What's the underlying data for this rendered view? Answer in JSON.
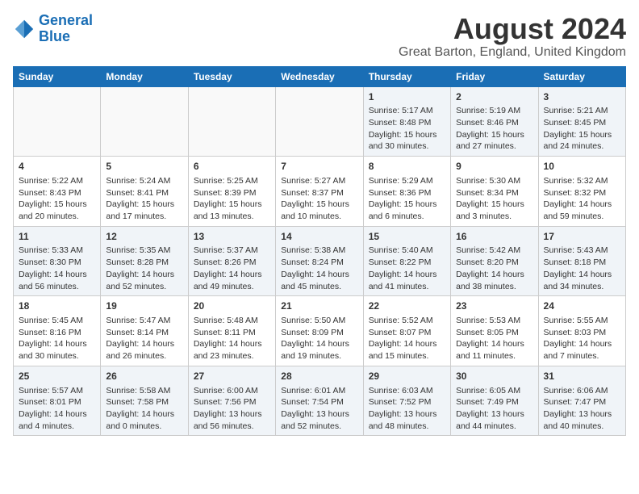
{
  "logo": {
    "line1": "General",
    "line2": "Blue"
  },
  "title": "August 2024",
  "subtitle": "Great Barton, England, United Kingdom",
  "days_of_week": [
    "Sunday",
    "Monday",
    "Tuesday",
    "Wednesday",
    "Thursday",
    "Friday",
    "Saturday"
  ],
  "weeks": [
    [
      {
        "day": "",
        "content": ""
      },
      {
        "day": "",
        "content": ""
      },
      {
        "day": "",
        "content": ""
      },
      {
        "day": "",
        "content": ""
      },
      {
        "day": "1",
        "content": "Sunrise: 5:17 AM\nSunset: 8:48 PM\nDaylight: 15 hours\nand 30 minutes."
      },
      {
        "day": "2",
        "content": "Sunrise: 5:19 AM\nSunset: 8:46 PM\nDaylight: 15 hours\nand 27 minutes."
      },
      {
        "day": "3",
        "content": "Sunrise: 5:21 AM\nSunset: 8:45 PM\nDaylight: 15 hours\nand 24 minutes."
      }
    ],
    [
      {
        "day": "4",
        "content": "Sunrise: 5:22 AM\nSunset: 8:43 PM\nDaylight: 15 hours\nand 20 minutes."
      },
      {
        "day": "5",
        "content": "Sunrise: 5:24 AM\nSunset: 8:41 PM\nDaylight: 15 hours\nand 17 minutes."
      },
      {
        "day": "6",
        "content": "Sunrise: 5:25 AM\nSunset: 8:39 PM\nDaylight: 15 hours\nand 13 minutes."
      },
      {
        "day": "7",
        "content": "Sunrise: 5:27 AM\nSunset: 8:37 PM\nDaylight: 15 hours\nand 10 minutes."
      },
      {
        "day": "8",
        "content": "Sunrise: 5:29 AM\nSunset: 8:36 PM\nDaylight: 15 hours\nand 6 minutes."
      },
      {
        "day": "9",
        "content": "Sunrise: 5:30 AM\nSunset: 8:34 PM\nDaylight: 15 hours\nand 3 minutes."
      },
      {
        "day": "10",
        "content": "Sunrise: 5:32 AM\nSunset: 8:32 PM\nDaylight: 14 hours\nand 59 minutes."
      }
    ],
    [
      {
        "day": "11",
        "content": "Sunrise: 5:33 AM\nSunset: 8:30 PM\nDaylight: 14 hours\nand 56 minutes."
      },
      {
        "day": "12",
        "content": "Sunrise: 5:35 AM\nSunset: 8:28 PM\nDaylight: 14 hours\nand 52 minutes."
      },
      {
        "day": "13",
        "content": "Sunrise: 5:37 AM\nSunset: 8:26 PM\nDaylight: 14 hours\nand 49 minutes."
      },
      {
        "day": "14",
        "content": "Sunrise: 5:38 AM\nSunset: 8:24 PM\nDaylight: 14 hours\nand 45 minutes."
      },
      {
        "day": "15",
        "content": "Sunrise: 5:40 AM\nSunset: 8:22 PM\nDaylight: 14 hours\nand 41 minutes."
      },
      {
        "day": "16",
        "content": "Sunrise: 5:42 AM\nSunset: 8:20 PM\nDaylight: 14 hours\nand 38 minutes."
      },
      {
        "day": "17",
        "content": "Sunrise: 5:43 AM\nSunset: 8:18 PM\nDaylight: 14 hours\nand 34 minutes."
      }
    ],
    [
      {
        "day": "18",
        "content": "Sunrise: 5:45 AM\nSunset: 8:16 PM\nDaylight: 14 hours\nand 30 minutes."
      },
      {
        "day": "19",
        "content": "Sunrise: 5:47 AM\nSunset: 8:14 PM\nDaylight: 14 hours\nand 26 minutes."
      },
      {
        "day": "20",
        "content": "Sunrise: 5:48 AM\nSunset: 8:11 PM\nDaylight: 14 hours\nand 23 minutes."
      },
      {
        "day": "21",
        "content": "Sunrise: 5:50 AM\nSunset: 8:09 PM\nDaylight: 14 hours\nand 19 minutes."
      },
      {
        "day": "22",
        "content": "Sunrise: 5:52 AM\nSunset: 8:07 PM\nDaylight: 14 hours\nand 15 minutes."
      },
      {
        "day": "23",
        "content": "Sunrise: 5:53 AM\nSunset: 8:05 PM\nDaylight: 14 hours\nand 11 minutes."
      },
      {
        "day": "24",
        "content": "Sunrise: 5:55 AM\nSunset: 8:03 PM\nDaylight: 14 hours\nand 7 minutes."
      }
    ],
    [
      {
        "day": "25",
        "content": "Sunrise: 5:57 AM\nSunset: 8:01 PM\nDaylight: 14 hours\nand 4 minutes."
      },
      {
        "day": "26",
        "content": "Sunrise: 5:58 AM\nSunset: 7:58 PM\nDaylight: 14 hours\nand 0 minutes."
      },
      {
        "day": "27",
        "content": "Sunrise: 6:00 AM\nSunset: 7:56 PM\nDaylight: 13 hours\nand 56 minutes."
      },
      {
        "day": "28",
        "content": "Sunrise: 6:01 AM\nSunset: 7:54 PM\nDaylight: 13 hours\nand 52 minutes."
      },
      {
        "day": "29",
        "content": "Sunrise: 6:03 AM\nSunset: 7:52 PM\nDaylight: 13 hours\nand 48 minutes."
      },
      {
        "day": "30",
        "content": "Sunrise: 6:05 AM\nSunset: 7:49 PM\nDaylight: 13 hours\nand 44 minutes."
      },
      {
        "day": "31",
        "content": "Sunrise: 6:06 AM\nSunset: 7:47 PM\nDaylight: 13 hours\nand 40 minutes."
      }
    ]
  ]
}
